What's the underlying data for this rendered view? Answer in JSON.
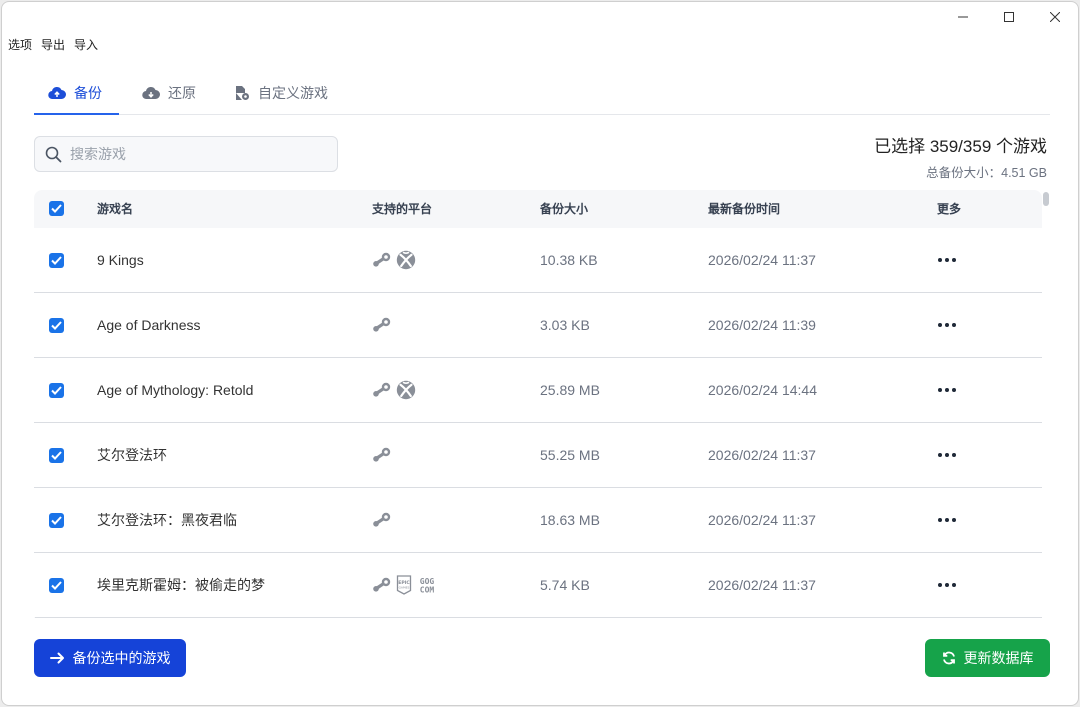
{
  "menu": [
    "选项",
    "导出",
    "导入"
  ],
  "tabs": [
    {
      "label": "备份",
      "icon": "cloud-upload-icon",
      "active": true
    },
    {
      "label": "还原",
      "icon": "cloud-download-icon",
      "active": false
    },
    {
      "label": "自定义游戏",
      "icon": "file-gear-icon",
      "active": false
    }
  ],
  "search": {
    "placeholder": "搜索游戏",
    "value": ""
  },
  "summary": {
    "selected": "已选择 359/359 个游戏",
    "total_size": "总备份大小：4.51 GB"
  },
  "table": {
    "headers": {
      "name": "游戏名",
      "platforms": "支持的平台",
      "size": "备份大小",
      "time": "最新备份时间",
      "more": "更多"
    },
    "rows": [
      {
        "name": "9 Kings",
        "platforms": [
          "steam",
          "xbox"
        ],
        "size": "10.38 KB",
        "time": "2026/02/24 11:37"
      },
      {
        "name": "Age of Darkness",
        "platforms": [
          "steam"
        ],
        "size": "3.03 KB",
        "time": "2026/02/24 11:39"
      },
      {
        "name": "Age of Mythology: Retold",
        "platforms": [
          "steam",
          "xbox"
        ],
        "size": "25.89 MB",
        "time": "2026/02/24 14:44"
      },
      {
        "name": "艾尔登法环",
        "platforms": [
          "steam"
        ],
        "size": "55.25 MB",
        "time": "2026/02/24 11:37"
      },
      {
        "name": "艾尔登法环：黑夜君临",
        "platforms": [
          "steam"
        ],
        "size": "18.63 MB",
        "time": "2026/02/24 11:37"
      },
      {
        "name": "埃里克斯霍姆：被偷走的梦",
        "platforms": [
          "steam",
          "epic",
          "gog"
        ],
        "size": "5.74 KB",
        "time": "2026/02/24 11:37"
      }
    ]
  },
  "buttons": {
    "backup": "备份选中的游戏",
    "update_db": "更新数据库"
  },
  "colors": {
    "accent": "#1a73e8",
    "primary_button": "#1543d8",
    "success_button": "#16a34a"
  }
}
